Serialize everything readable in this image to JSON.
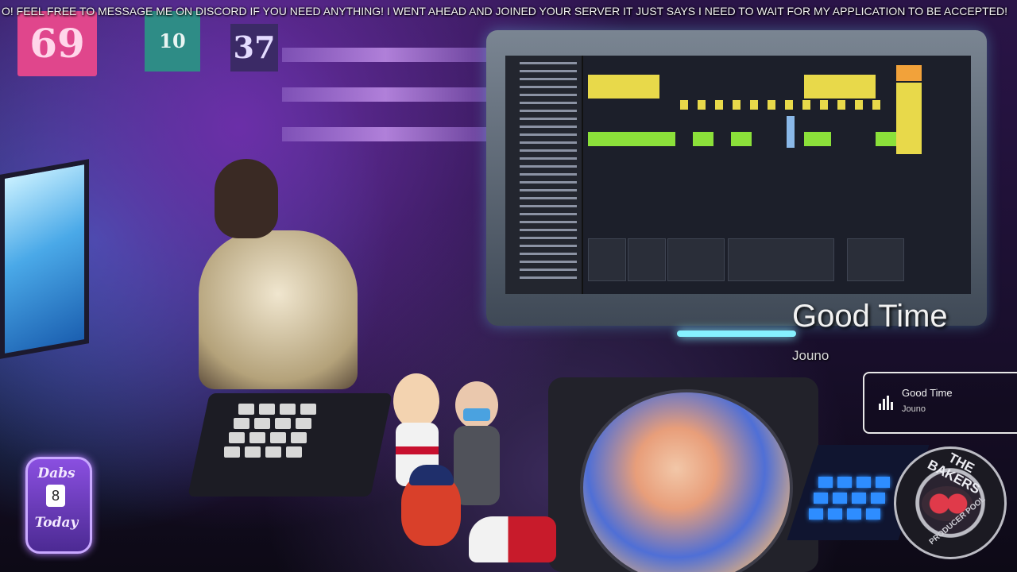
{
  "ticker": {
    "text": "O! FEEL FREE TO MESSAGE ME ON DISCORD IF YOU NEED ANYTHING! I WENT AHEAD AND JOINED YOUR SERVER IT JUST SAYS I NEED TO WAIT FOR MY APPLICATION TO BE ACCEPTED!"
  },
  "jerseys": {
    "left": "69",
    "middle": "10",
    "right": "37"
  },
  "now_playing": {
    "title": "Good Time",
    "artist": "Jouno",
    "card_title": "Good Time",
    "card_artist": "Jouno"
  },
  "dabs_badge": {
    "top": "Dabs",
    "number": "8",
    "bottom": "Today"
  },
  "bakers_logo": {
    "top": "THE BAKERS",
    "bottom": "PRODUCER POOL"
  },
  "colors": {
    "accent": "#86f1ff",
    "clip_yellow": "#e8d94a",
    "clip_green": "#8be03a",
    "badge_purple": "#8a4fe0"
  },
  "icons": {
    "now_playing": "audio-bars-icon"
  }
}
